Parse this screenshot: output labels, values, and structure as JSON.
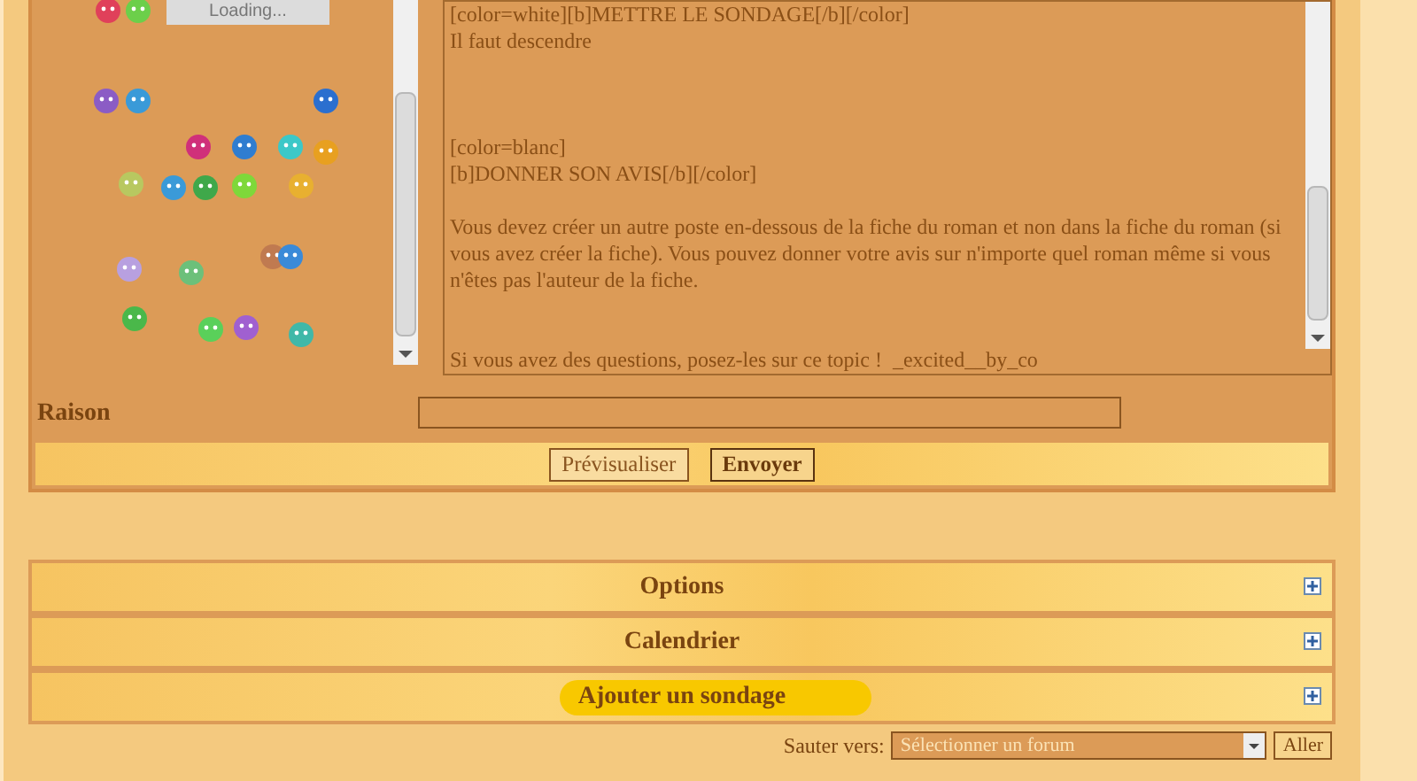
{
  "smilies_panel": {
    "loading_label": "Loading..."
  },
  "message": {
    "value": "[color=white][b]METTRE LE SONDAGE[/b][/color]\nIl faut descendre\n\n\n\n[color=blanc]\n[b]DONNER SON AVIS[/b][/color]\n\nVous devez créer un autre poste en-dessous de la fiche du roman et non dans la fiche du roman (si vous avez créer la fiche). Vous pouvez donner votre avis sur n'importe quel roman même si vous n'êtes pas l'auteur de la fiche.\n\n\nSi vous avez des questions, posez-les sur ce topic !  _excited__by_co"
  },
  "reason": {
    "label": "Raison"
  },
  "buttons": [
    {
      "label": "Prévisualiser",
      "kind": "secondary"
    },
    {
      "label": "Envoyer",
      "kind": "primary"
    }
  ],
  "sections": [
    {
      "title": "Options",
      "expanded": false,
      "highlighted": false
    },
    {
      "title": "Calendrier",
      "expanded": false,
      "highlighted": false
    },
    {
      "title": "Ajouter un sondage",
      "expanded": false,
      "highlighted": true
    }
  ],
  "jump": {
    "label": "Sauter vers:",
    "placeholder": "Sélectionner un forum",
    "button": "Aller"
  }
}
